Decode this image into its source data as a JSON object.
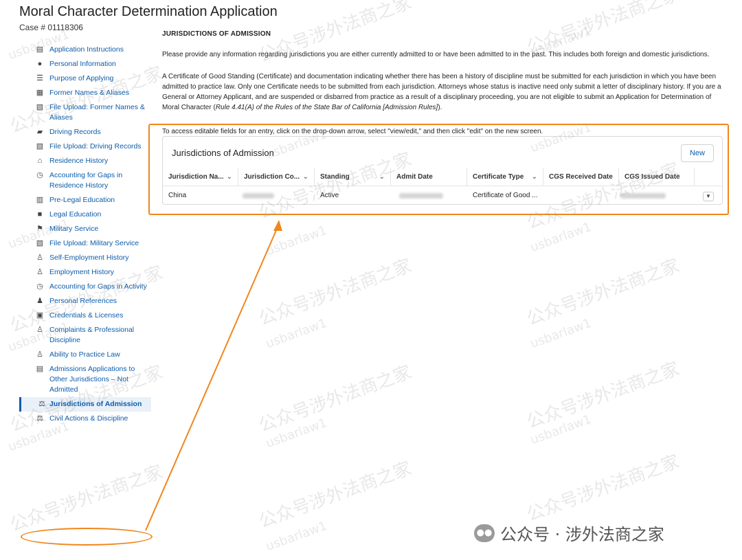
{
  "header": {
    "title": "Moral Character Determination Application",
    "case_number": "Case # 01118306"
  },
  "sidebar": {
    "items": [
      {
        "label": "Application Instructions",
        "icon": "list-icon"
      },
      {
        "label": "Personal Information",
        "icon": "person-icon"
      },
      {
        "label": "Purpose of Applying",
        "icon": "checklist-icon"
      },
      {
        "label": "Former Names & Aliases",
        "icon": "id-card-icon"
      },
      {
        "label": "File Upload: Former Names & Aliases",
        "icon": "file-icon"
      },
      {
        "label": "Driving Records",
        "icon": "car-icon"
      },
      {
        "label": "File Upload: Driving Records",
        "icon": "file-icon"
      },
      {
        "label": "Residence History",
        "icon": "home-icon"
      },
      {
        "label": "Accounting for Gaps in Residence History",
        "icon": "clock-icon"
      },
      {
        "label": "Pre-Legal Education",
        "icon": "books-icon"
      },
      {
        "label": "Legal Education",
        "icon": "briefcase-icon"
      },
      {
        "label": "Military Service",
        "icon": "flag-icon"
      },
      {
        "label": "File Upload: Military Service",
        "icon": "file-icon"
      },
      {
        "label": "Self-Employment History",
        "icon": "worker-icon"
      },
      {
        "label": "Employment History",
        "icon": "worker-icon"
      },
      {
        "label": "Accounting for Gaps in Activity",
        "icon": "clock-icon"
      },
      {
        "label": "Personal References",
        "icon": "people-icon"
      },
      {
        "label": "Credentials & Licenses",
        "icon": "certificate-icon"
      },
      {
        "label": "Complaints & Professional Discipline",
        "icon": "person-warning-icon"
      },
      {
        "label": "Ability to Practice Law",
        "icon": "person-warning-icon"
      },
      {
        "label": "Admissions Applications to Other Jurisdictions – Not Admitted",
        "icon": "document-icon"
      },
      {
        "label": "Jurisdictions of Admission",
        "icon": "gavel-icon",
        "active": true
      },
      {
        "label": "Civil Actions & Discipline",
        "icon": "gavel-icon"
      }
    ]
  },
  "main": {
    "section_title": "JURISDICTIONS OF ADMISSION",
    "intro": "Please provide any information regarding jurisdictions you are either currently admitted to or have been admitted to in the past. This includes both foreign and domestic jurisdictions.",
    "para_main": "A Certificate of Good Standing (Certificate) and documentation indicating whether there has been a history of discipline must be submitted for each jurisdiction in which you have been admitted to practice law. Only one Certificate needs to be submitted from each jurisdiction. Attorneys whose status is inactive need only submit a letter of disciplinary history. If you are a General or Attorney Applicant, and are suspended or disbarred from practice as a result of a disciplinary proceeding, you are not eligible to submit an Application for Determination of Moral Character (",
    "para_rule": "Rule 4.41(A) of the Rules of the State Bar of California [Admission Rules]",
    "para_end": ").",
    "hint": "To access editable fields for an entry, click on the drop-down arrow, select \"view/edit,\" and then click \"edit\" on the new screen."
  },
  "table": {
    "title": "Jurisdictions of Admission",
    "new_label": "New",
    "columns": [
      "Jurisdiction Na...",
      "Jurisdiction Co...",
      "Standing",
      "Admit Date",
      "Certificate Type",
      "CGS Received Date",
      "CGS Issued Date"
    ],
    "rows": [
      {
        "jurisdiction_name": "China",
        "jurisdiction_code": "",
        "standing": "Active",
        "admit_date": "",
        "certificate_type": "Certificate of Good ...",
        "cgs_received": "",
        "cgs_issued": ""
      }
    ]
  },
  "watermarks": {
    "text_cn": "公众号涉外法商之家",
    "text_en": "usbarlaw1",
    "footer": "公众号 · 涉外法商之家"
  },
  "colors": {
    "link": "#0b5cab",
    "highlight": "#f0861c"
  }
}
